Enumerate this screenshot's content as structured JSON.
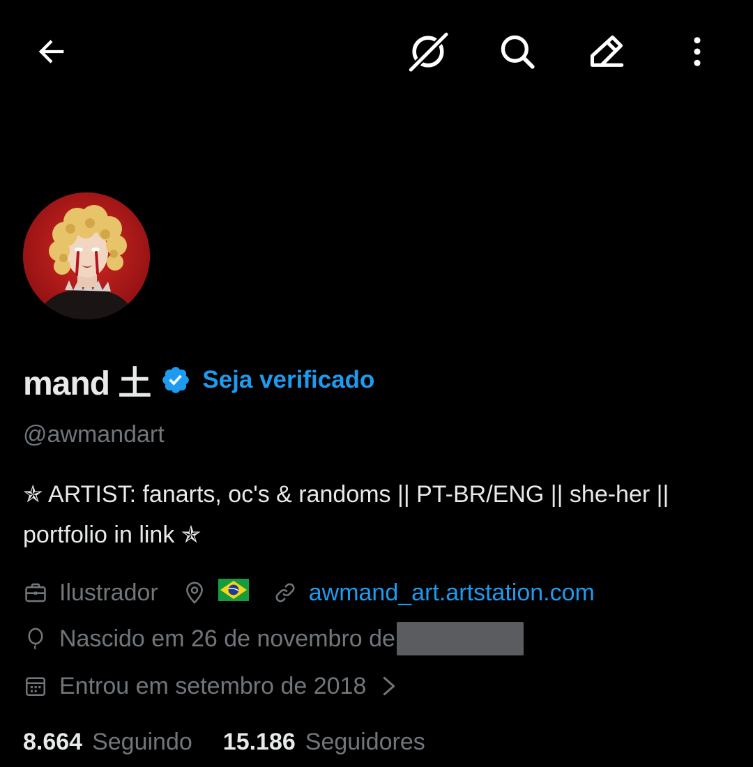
{
  "header": {
    "icons": {
      "back": "arrow-left-icon",
      "grok": "grok-icon",
      "search": "search-icon",
      "edit": "edit-pencil-icon",
      "more": "more-vertical-icon"
    }
  },
  "profile": {
    "display_name": "mand 土",
    "verified_cta": "Seja verificado",
    "handle": "@awmandart",
    "bio": "✯ ARTIST: fanarts, oc's & randoms || PT-BR/ENG || she-her || portfolio in link ✯",
    "profession": "Ilustrador",
    "location_flag": "🇧🇷",
    "website": "awmand_art.artstation.com",
    "birthday": "Nascido em 26 de novembro de",
    "joined": "Entrou em setembro de 2018",
    "following_count": "8.664",
    "following_label": "Seguindo",
    "followers_count": "15.186",
    "followers_label": "Seguidores"
  },
  "colors": {
    "background": "#000000",
    "text_primary": "#e7e9ea",
    "text_secondary": "#71767b",
    "accent": "#1d9bf0"
  }
}
